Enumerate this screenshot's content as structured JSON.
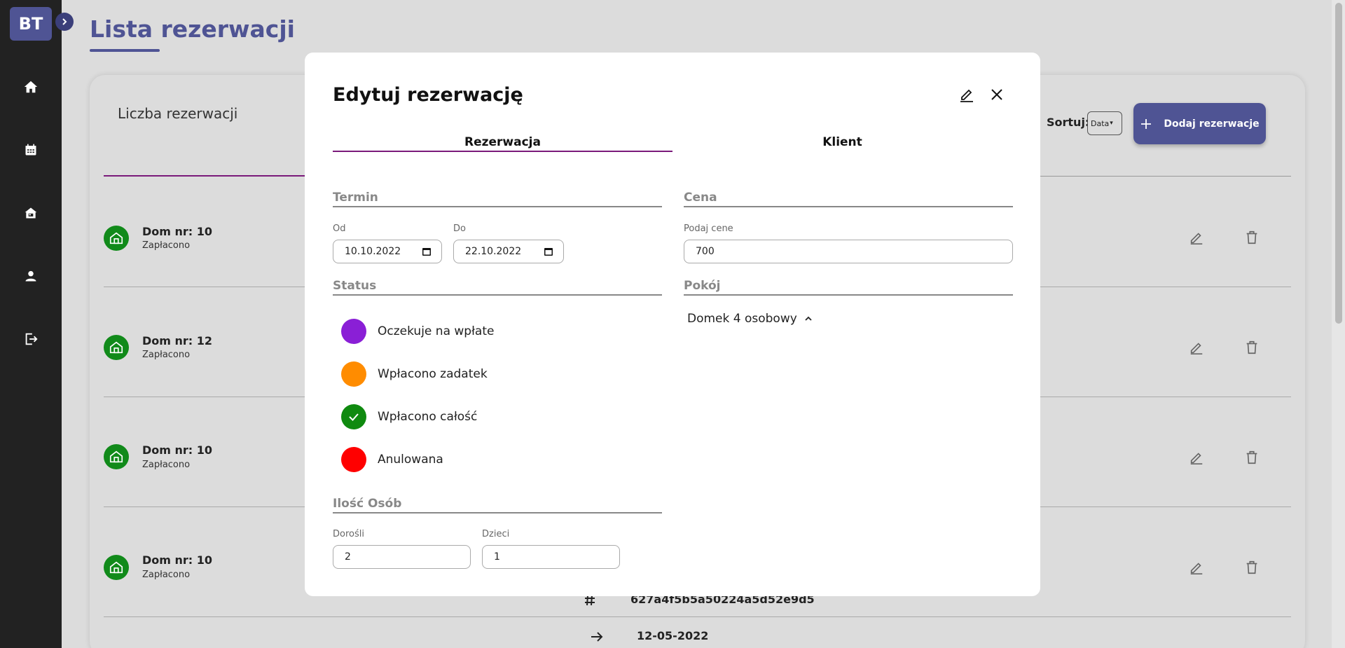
{
  "app": {
    "logo": "BT",
    "page_title": "Lista rezerwacji"
  },
  "sidebar": {
    "items": [
      {
        "icon": "home-icon"
      },
      {
        "icon": "calendar-icon"
      },
      {
        "icon": "cabin-icon"
      },
      {
        "icon": "user-icon"
      },
      {
        "icon": "logout-icon"
      }
    ]
  },
  "list": {
    "count_label": "Liczba rezerwacji",
    "sort_label": "Sortuj:",
    "sort_value": "Data",
    "add_button": "Dodaj rezerwacje",
    "rows": [
      {
        "title": "Dom nr: 10",
        "status": "Zapłacono"
      },
      {
        "title": "Dom nr: 12",
        "status": "Zapłacono"
      },
      {
        "title": "Dom nr: 10",
        "status": "Zapłacono"
      },
      {
        "title": "Dom nr: 10",
        "status": "Zapłacono"
      }
    ],
    "detail_id": "627a4f5b5a50224a5d52e9d5",
    "detail_date": "12-05-2022"
  },
  "modal": {
    "title": "Edytuj rezerwację",
    "tabs": [
      "Rezerwacja",
      "Klient"
    ],
    "termin": {
      "label": "Termin",
      "from_label": "Od",
      "from_value": "10.10.2022",
      "to_label": "Do",
      "to_value": "22.10.2022"
    },
    "cena": {
      "label": "Cena",
      "field_label": "Podaj cene",
      "value": "700"
    },
    "status": {
      "label": "Status",
      "options": [
        {
          "label": "Oczekuje na wpłate",
          "color": "#8a1fd6"
        },
        {
          "label": "Wpłacono zadatek",
          "color": "#ff8c00"
        },
        {
          "label": "Wpłacono całość",
          "color": "#0f8a0f"
        },
        {
          "label": "Anulowana",
          "color": "#ff0000"
        }
      ]
    },
    "pokoj": {
      "label": "Pokój",
      "value": "Domek 4 osobowy"
    },
    "osoby": {
      "label": "Ilość Osób",
      "adults_label": "Dorośli",
      "adults_value": "2",
      "children_label": "Dzieci",
      "children_value": "1"
    }
  },
  "colors": {
    "brand": "#4f5494",
    "accent": "#7a1a7a",
    "sidebar": "#222222",
    "house": "#118a1a"
  }
}
